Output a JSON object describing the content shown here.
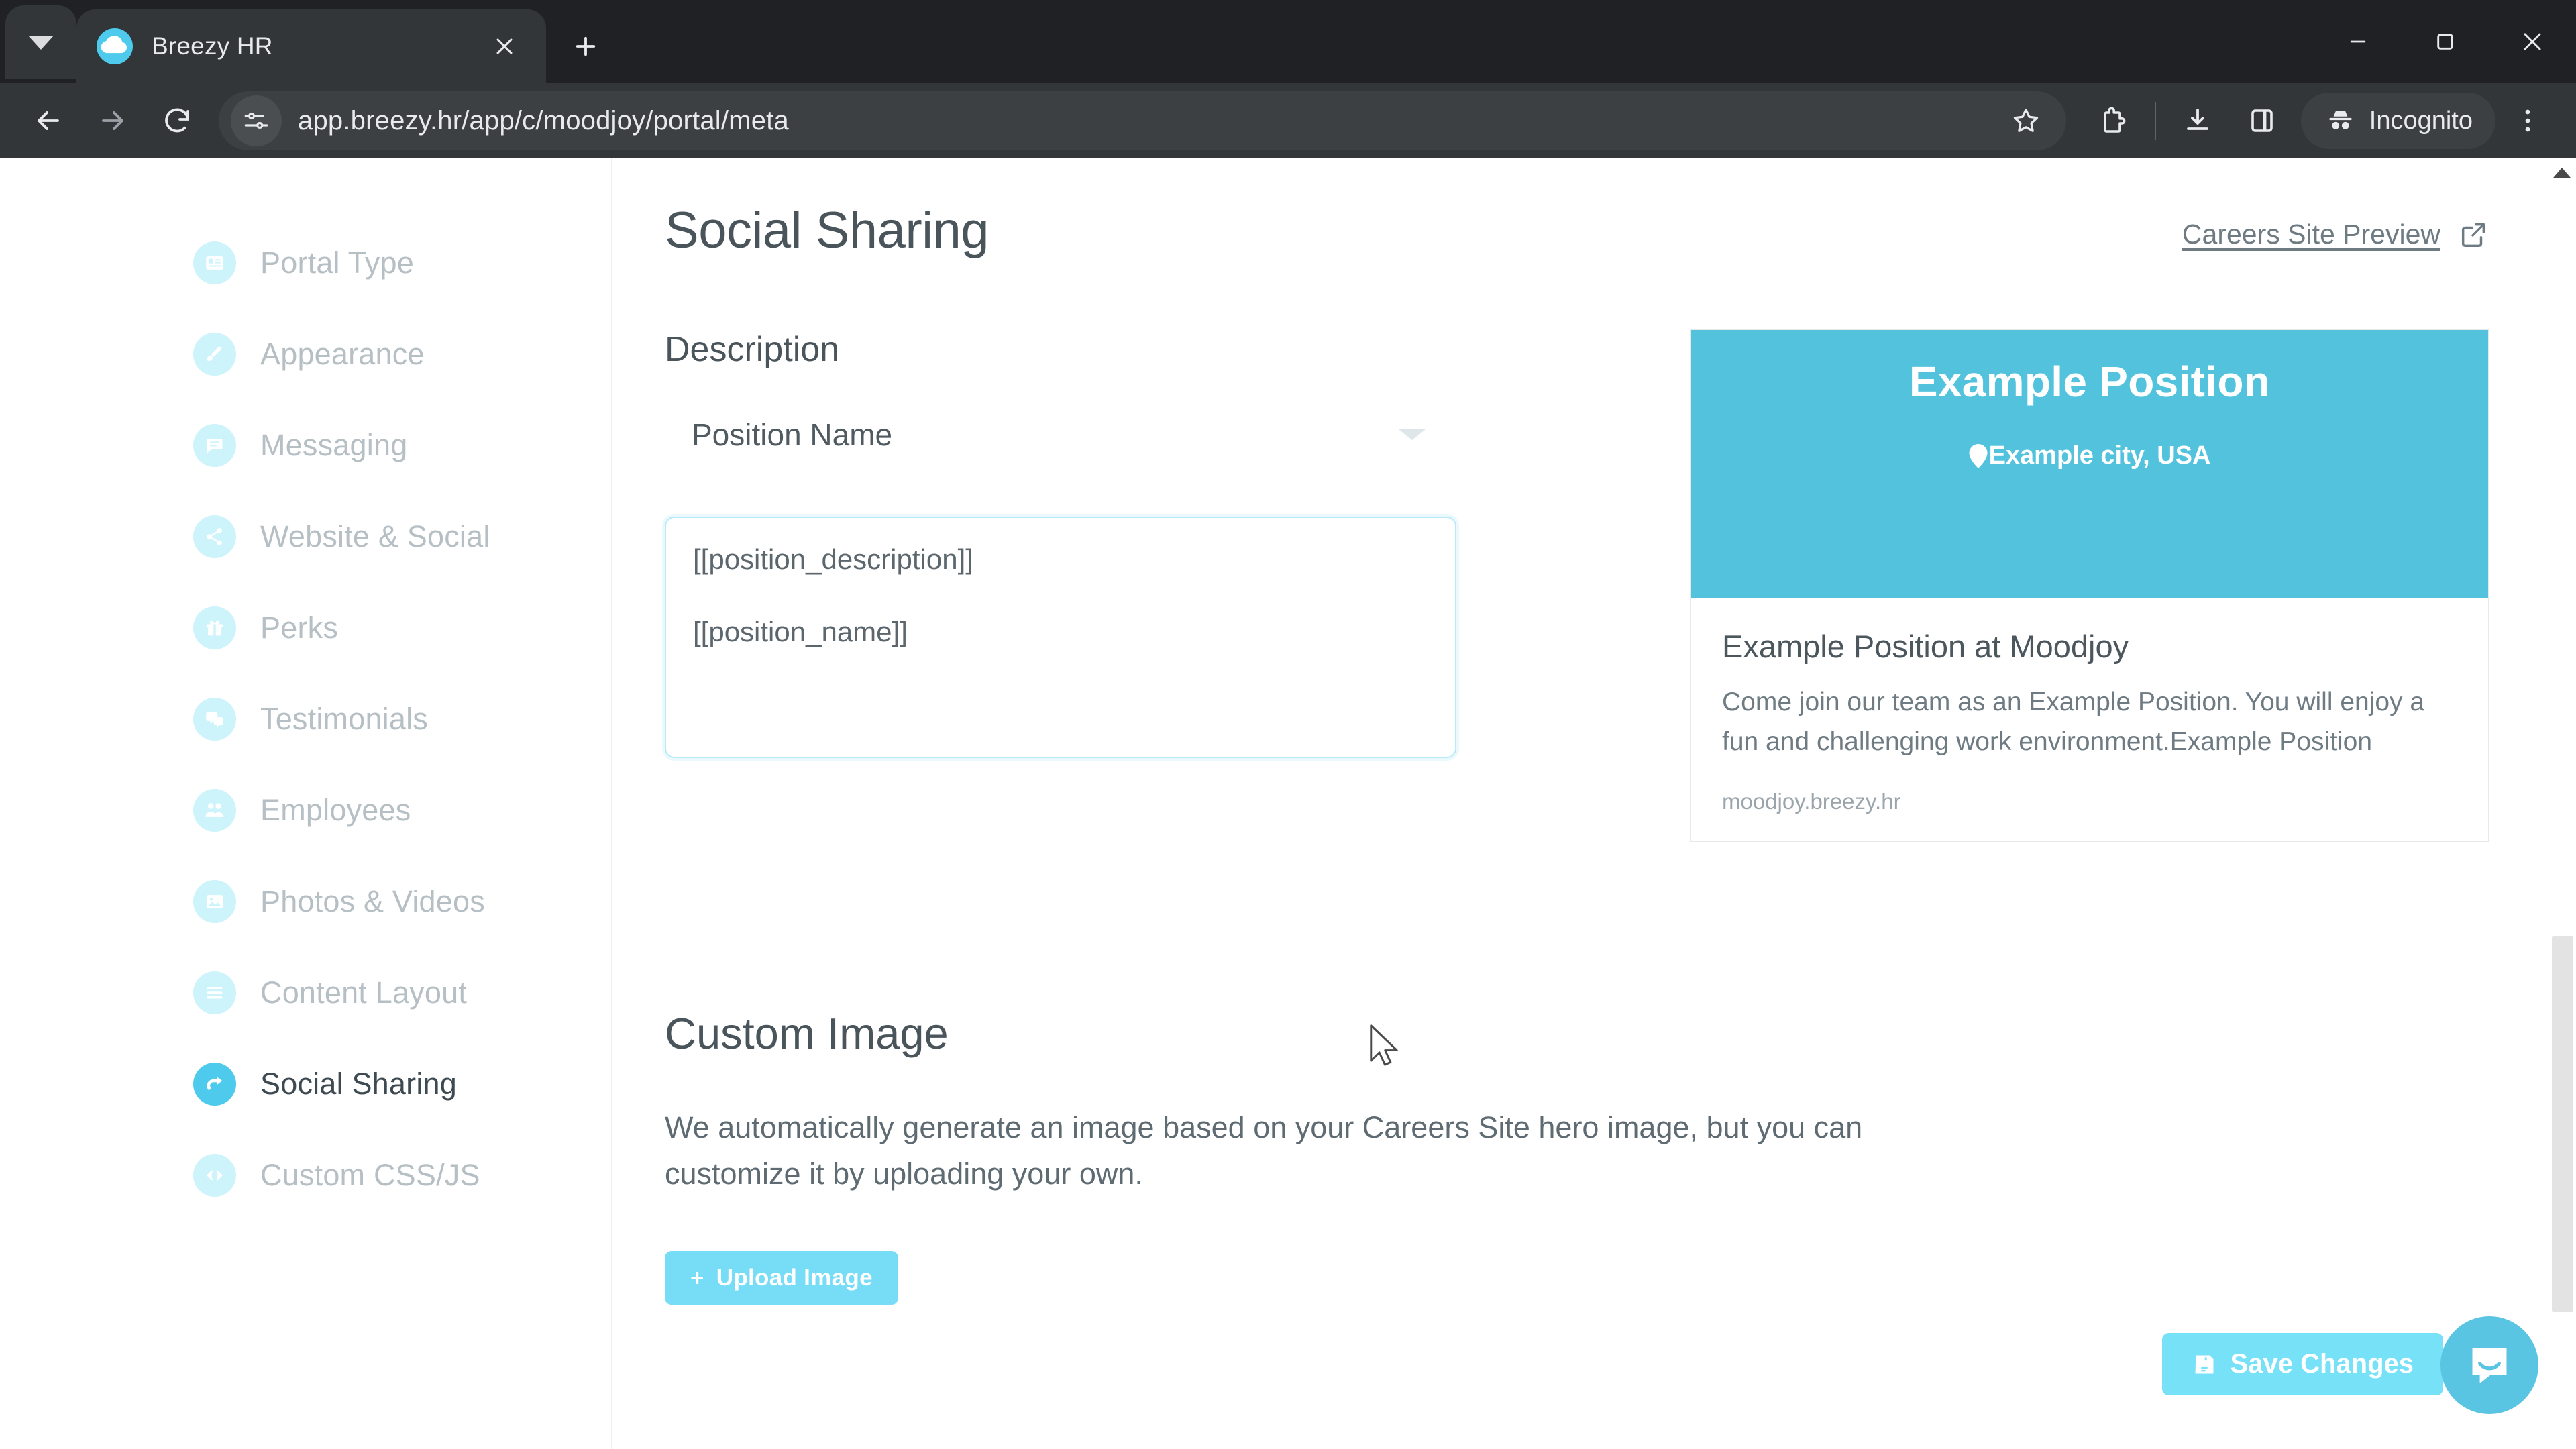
{
  "browser": {
    "tab": {
      "title": "Breezy HR",
      "favicon": "cloud-icon"
    },
    "tab_menu_icon": "chevron-down-icon",
    "new_tab_icon": "plus-icon",
    "window_controls": [
      "minimize-icon",
      "maximize-icon",
      "close-icon"
    ],
    "nav": {
      "back": "back-arrow-icon",
      "forward": "forward-arrow-icon",
      "reload": "reload-icon"
    },
    "omnibox": {
      "site_settings_icon": "tune-icon",
      "url": "app.breezy.hr/app/c/moodjoy/portal/meta",
      "bookmark_icon": "star-icon"
    },
    "toolbar_icons": [
      "extensions-icon",
      "downloads-icon",
      "side-panel-icon",
      "kebab-menu-icon"
    ],
    "profile": {
      "label": "Incognito",
      "icon": "incognito-icon"
    }
  },
  "sidebar": {
    "items": [
      {
        "label": "Portal Type",
        "icon": "portal-type-icon",
        "active": false
      },
      {
        "label": "Appearance",
        "icon": "brush-icon",
        "active": false
      },
      {
        "label": "Messaging",
        "icon": "message-icon",
        "active": false
      },
      {
        "label": "Website & Social",
        "icon": "share-icon",
        "active": false
      },
      {
        "label": "Perks",
        "icon": "gift-icon",
        "active": false
      },
      {
        "label": "Testimonials",
        "icon": "quote-icon",
        "active": false
      },
      {
        "label": "Employees",
        "icon": "people-icon",
        "active": false
      },
      {
        "label": "Photos & Videos",
        "icon": "media-icon",
        "active": false
      },
      {
        "label": "Content Layout",
        "icon": "layout-icon",
        "active": false
      },
      {
        "label": "Social Sharing",
        "icon": "social-share-icon",
        "active": true
      },
      {
        "label": "Custom CSS/JS",
        "icon": "code-icon",
        "active": false
      }
    ]
  },
  "main": {
    "title": "Social Sharing",
    "preview_link": {
      "label": "Careers Site Preview",
      "icon": "external-link-icon"
    },
    "description": {
      "label": "Description",
      "select_value": "Position Name",
      "select_chevron": "chevron-down-icon",
      "textarea_lines": [
        "[[position_description]]",
        "[[position_name]]"
      ]
    },
    "preview_card": {
      "hero_title": "Example Position",
      "hero_location": "Example city, USA",
      "hero_location_icon": "map-pin-icon",
      "heading": "Example Position at Moodjoy",
      "body": "Come join our team as an Example Position. You will enjoy a fun and challenging work environment.Example Position",
      "url": "moodjoy.breezy.hr"
    },
    "custom_image": {
      "title": "Custom Image",
      "description": "We automatically generate an image based on your Careers Site hero image, but you can customize it by uploading your own.",
      "upload_button": {
        "label": "Upload Image",
        "plus": "+"
      }
    }
  },
  "footer": {
    "save_button": {
      "label": "Save Changes",
      "icon": "save-disk-icon"
    }
  },
  "widgets": {
    "intercom": "chat-bubble-icon"
  },
  "colors": {
    "brand_cyan": "#4dcaec",
    "hero_cyan": "#53c3dd",
    "button_cyan": "#77e1f7",
    "sidebar_inactive_icon": "#cdf3fb",
    "sidebar_inactive_text": "#b6bfc4",
    "chrome_dark": "#323639",
    "tabstrip_dark": "#202124"
  }
}
